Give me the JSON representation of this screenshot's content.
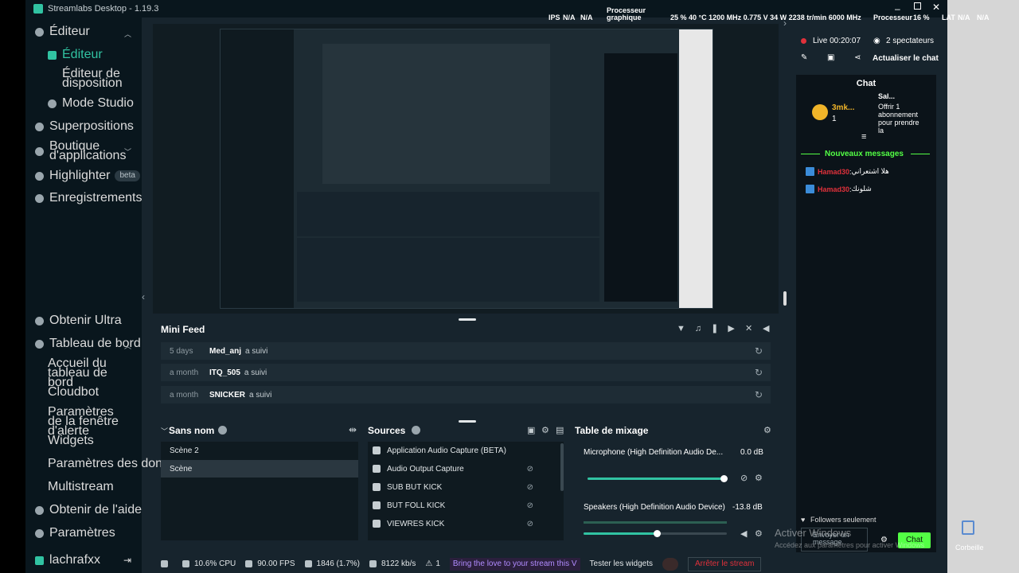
{
  "window": {
    "title": "Streamlabs Desktop - 1.19.3",
    "stats": {
      "ips": "IPS",
      "ips_val": "N/A",
      "ips_val2": "N/A",
      "gpu_label": "Processeur graphique",
      "gpu_stats": "25 % 40 °C 1200 MHz 0.775 V 34 W 2238 tr/min 6000 MHz",
      "cpu_label": "Processeur",
      "cpu_val": "16 %",
      "lat": "LAT",
      "lat_val": "N/A",
      "lat_val2": "N/A"
    }
  },
  "sidebar": {
    "editor": "Éditeur",
    "editor_sub": [
      "Éditeur",
      "Éditeur de disposition",
      "Mode Studio"
    ],
    "overlays": "Superpositions",
    "appstore": "Boutique d'applications",
    "highlighter": "Highlighter",
    "beta": "beta",
    "recordings": "Enregistrements",
    "ultra": "Obtenir Ultra",
    "dashboard": "Tableau de bord",
    "dashboard_sub": [
      "Accueil du tableau de bord",
      "Cloudbot",
      "Paramètres de la fenêtre d'alerte",
      "Widgets",
      "Paramètres des dons",
      "Multistream"
    ],
    "help": "Obtenir de l'aide",
    "settings": "Paramètres",
    "user": "lachrafxx"
  },
  "minifeed": {
    "title": "Mini Feed",
    "rows": [
      {
        "when": "5 days",
        "who": "Med_anj",
        "act": "a suivi"
      },
      {
        "when": "a month",
        "who": "ITQ_505",
        "act": "a suivi"
      },
      {
        "when": "a month",
        "who": "SNICKER",
        "act": "a suivi"
      }
    ]
  },
  "scenes": {
    "title": "Sans nom",
    "items": [
      "Scène 2",
      "Scène"
    ]
  },
  "sources": {
    "title": "Sources",
    "items": [
      "Application Audio Capture (BETA)",
      "Audio Output Capture",
      "SUB BUT KICK",
      "BUT FOLL KICK",
      "VIEWRES KICK"
    ]
  },
  "mixer": {
    "title": "Table de mixage",
    "channels": [
      {
        "name": "Microphone (High Definition Audio De...",
        "db": "0.0 dB",
        "level": 0.98
      },
      {
        "name": "Speakers (High Definition Audio Device)",
        "db": "-13.8 dB",
        "level": 0.51
      }
    ]
  },
  "statusbar": {
    "cpu": "10.6% CPU",
    "fps": "90.00 FPS",
    "dropped": "1846 (1.7%)",
    "bitrate": "8122 kb/s",
    "alerts": "1",
    "promo": "Bring the love to your stream this V",
    "test_widgets": "Tester les widgets",
    "stop": "Arrêter le stream"
  },
  "live": {
    "status": "Live 00:20:07",
    "viewers": "2 spectateurs",
    "refresh": "Actualiser le chat"
  },
  "chat": {
    "title": "Chat",
    "gift_user": "3mk...",
    "gift_count": "1",
    "gift_text": "Offrir 1 abonnement pour prendre la",
    "gift_user2": "Sal...",
    "new_messages": "Nouveaux messages",
    "messages": [
      {
        "name": "Hamad30",
        "text": "هلا اشتعراني"
      },
      {
        "name": "Hamad30",
        "text": "شلونك"
      }
    ],
    "followers_only": "Followers seulement",
    "input_placeholder": "Envoyer un message",
    "send": "Chat"
  },
  "watermark": {
    "line1": "Activer Windows",
    "line2": "Accédez aux paramètres pour activer Windows"
  },
  "desktop": {
    "trash": "Corbeille"
  },
  "colors": {
    "accent": "#31c3a2",
    "chat_btn": "#53ff45",
    "stop": "#e0313b",
    "bg": "#17242d",
    "sidebar": "#09161d"
  }
}
